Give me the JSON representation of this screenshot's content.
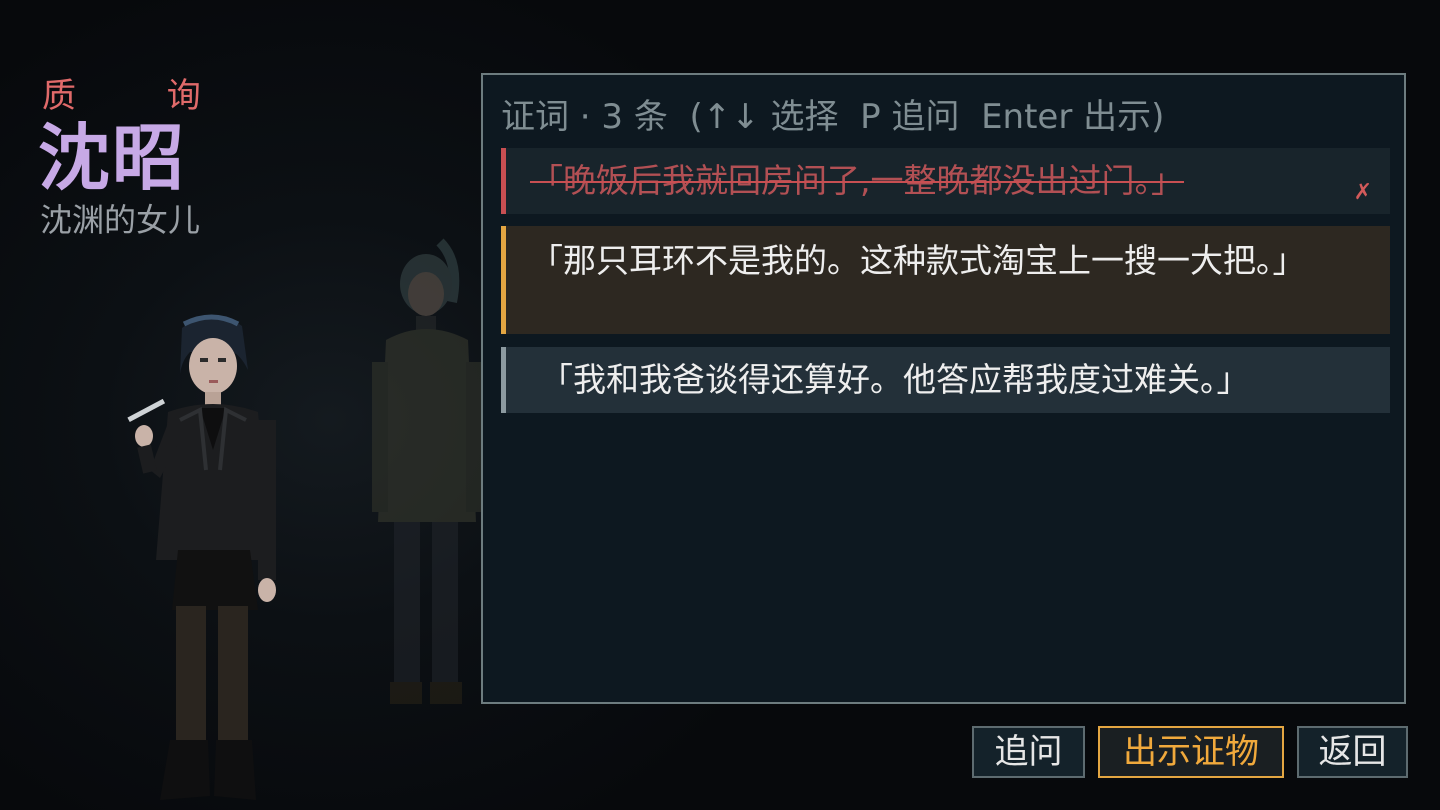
{
  "header": {
    "mode_label": "质 询",
    "character_name": "沈昭",
    "character_desc": "沈渊的女儿"
  },
  "testimony_panel": {
    "header": "证词 · 3 条  (↑↓ 选择  P 追问  Enter 出示)",
    "statements": [
      {
        "text": "「晚饭后我就回房间了,一整晚都没出过门。」",
        "state": "contradicted",
        "mark": "✗"
      },
      {
        "text": "「那只耳环不是我的。这种款式淘宝上一搜一大把。」",
        "state": "selected"
      },
      {
        "text": "「我和我爸谈得还算好。他答应帮我度过难关。」",
        "state": "normal"
      }
    ]
  },
  "buttons": {
    "press": "追问",
    "present": "出示证物",
    "back": "返回"
  },
  "colors": {
    "accent_orange": "#e3a642",
    "contradiction_red": "#c84f52",
    "name_purple": "#c7a9e6",
    "panel_bg": "#0d1820"
  }
}
